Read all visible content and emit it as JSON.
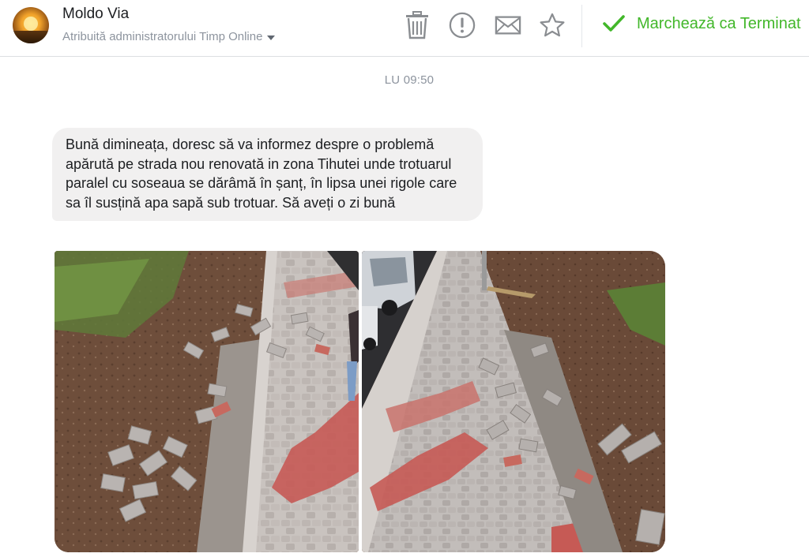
{
  "header": {
    "contact_name": "Moldo Via",
    "assignment_text": "Atribuită administratorului Timp Online",
    "actions": [
      {
        "name": "delete",
        "icon": "trash-icon"
      },
      {
        "name": "report",
        "icon": "exclamation-circle-icon"
      },
      {
        "name": "mark-unread",
        "icon": "envelope-icon"
      },
      {
        "name": "star",
        "icon": "star-icon"
      }
    ],
    "mark_done_label": "Marchează ca Terminat",
    "mark_done_icon": "checkmark-icon"
  },
  "conversation": {
    "timestamp": "LU 09:50",
    "message": {
      "text": "Bună dimineața, doresc să va informez despre o problemă apărută pe strada nou renovată in zona Tihutei unde trotuarul paralel cu soseaua se dărâmă în șanț, în lipsa unei rigole care sa îl susțină apa sapă sub trotuar. Să aveți o zi bună"
    },
    "attachments": [
      {
        "type": "photo",
        "subject": "collapsed-sidewalk-photo-1"
      },
      {
        "type": "photo",
        "subject": "collapsed-sidewalk-photo-2"
      }
    ]
  },
  "colors": {
    "accent_green": "#42b72a",
    "bubble_bg": "#f1f0f0",
    "muted_text": "#8d949e",
    "icon_gray": "#8a8d91"
  }
}
